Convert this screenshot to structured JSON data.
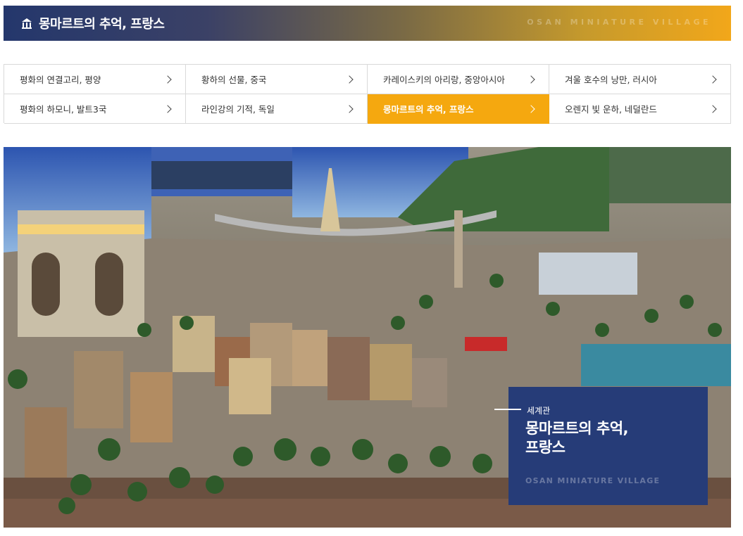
{
  "header": {
    "title": "몽마르트의 추억, 프랑스",
    "subtitle": "OSAN MINIATURE VILLAGE",
    "icon": "building-icon"
  },
  "nav": {
    "items": [
      {
        "label": "평화의 연결고리, 평양",
        "active": false
      },
      {
        "label": "황하의 선물, 중국",
        "active": false
      },
      {
        "label": "카레이스키의 아리랑, 중앙아시아",
        "active": false
      },
      {
        "label": "겨울 호수의 낭만, 러시아",
        "active": false
      },
      {
        "label": "평화의 하모니, 발트3국",
        "active": false
      },
      {
        "label": "라인강의 기적, 독일",
        "active": false
      },
      {
        "label": "몽마르트의 추억, 프랑스",
        "active": true
      },
      {
        "label": "오렌지 빛 운하, 네덜란드",
        "active": false
      }
    ],
    "chevron_icon": "chevron-right-icon"
  },
  "caption": {
    "category": "세계관",
    "title_line1": "몽마르트의 추억,",
    "title_line2": "프랑스",
    "subtitle": "OSAN MINIATURE VILLAGE"
  },
  "colors": {
    "navy": "#263c78",
    "accent": "#f5a80f"
  }
}
